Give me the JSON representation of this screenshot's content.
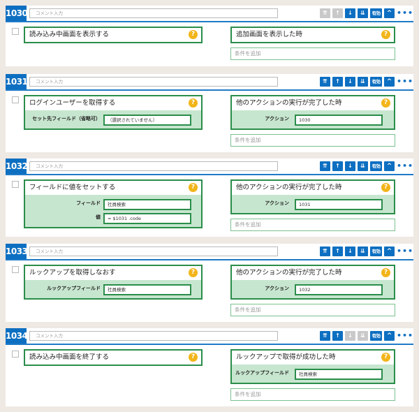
{
  "comment_placeholder": "コメント入力",
  "add_condition_label": "条件を追加",
  "toolbar": {
    "move_top": "⇈",
    "move_up": "↑",
    "move_down": "↓",
    "move_bottom": "⇊",
    "enabled": "有効",
    "collapse": "^",
    "more": "•••"
  },
  "colors": {
    "accent": "#0d6fc1",
    "green": "#2a8d4a",
    "panel": "#c7e6cf",
    "help": "#f2b51a"
  },
  "steps": [
    {
      "number": "1030",
      "action": {
        "title": "読み込み中画面を表示する",
        "fields": []
      },
      "condition": {
        "title": "追加画面を表示した時",
        "fields": []
      },
      "disabled_tools": [
        "move_top",
        "move_up"
      ]
    },
    {
      "number": "1031",
      "action": {
        "title": "ログインユーザーを取得する",
        "fields": [
          {
            "label": "セット先フィールド（省略可）",
            "value": "（選択されていません）"
          }
        ]
      },
      "condition": {
        "title": "他のアクションの実行が完了した時",
        "fields": [
          {
            "label": "アクション",
            "value": "1030"
          }
        ]
      },
      "disabled_tools": []
    },
    {
      "number": "1032",
      "action": {
        "title": "フィールドに値をセットする",
        "fields": [
          {
            "label": "フィールド",
            "value": "社員検索"
          },
          {
            "label": "値",
            "value": "= $1031 .code"
          }
        ]
      },
      "condition": {
        "title": "他のアクションの実行が完了した時",
        "fields": [
          {
            "label": "アクション",
            "value": "1031"
          }
        ]
      },
      "disabled_tools": []
    },
    {
      "number": "1033",
      "action": {
        "title": "ルックアップを取得しなおす",
        "fields": [
          {
            "label": "ルックアップフィールド",
            "value": "社員検索"
          }
        ]
      },
      "condition": {
        "title": "他のアクションの実行が完了した時",
        "fields": [
          {
            "label": "アクション",
            "value": "1032"
          }
        ]
      },
      "disabled_tools": []
    },
    {
      "number": "1034",
      "action": {
        "title": "読み込み中画面を終了する",
        "fields": []
      },
      "condition": {
        "title": "ルックアップで取得が成功した時",
        "fields": [
          {
            "label": "ルックアップフィールド",
            "value": "社員検索"
          }
        ]
      },
      "disabled_tools": [
        "move_down",
        "move_bottom"
      ]
    }
  ]
}
